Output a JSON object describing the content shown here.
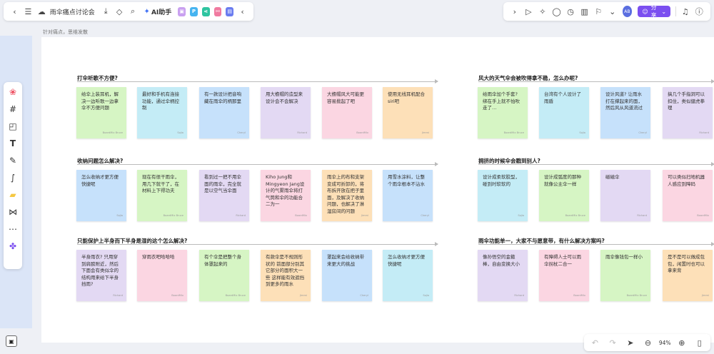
{
  "topbar": {
    "doc_title": "雨伞痛点讨论会",
    "ai_label": "AI助手",
    "share_label": "分享",
    "avatar_text": "AB",
    "colors": {
      "share": "#7b4ff0"
    }
  },
  "breadcrumb": "针对痛点，思维发散",
  "zoom": {
    "level": "94%"
  },
  "sections": [
    {
      "title": "打伞听歌不方便?",
      "notes": [
        {
          "text": "给伞上装耳机，解决一边听歌一边拿伞不方便问题",
          "author": "BoardMix Bruce",
          "color": "green"
        },
        {
          "text": "最好和手机有连接功能，通过伞柄控制",
          "author": "Sojia",
          "color": "cyan"
        },
        {
          "text": "有一款设计把音响藏在雨伞的柄那里",
          "author": "Cheryl",
          "color": "blue"
        },
        {
          "text": "用大檐帽的造型来设计会不会解决",
          "author": "Richard",
          "color": "purple"
        },
        {
          "text": "大檐帽风大可能更容易掀起了吧",
          "author": "BoardMix",
          "color": "pink"
        },
        {
          "text": "使用无线耳机配合siri吧",
          "author": "Jimmi",
          "color": "orange"
        }
      ]
    },
    {
      "title": "收纳问题怎么解决?",
      "notes": [
        {
          "text": "怎么收纳才更方便快捷呢",
          "author": "Sojia",
          "color": "blue"
        },
        {
          "text": "现在有很干雨伞，用几下就干了，在材料上下得功夫",
          "author": "BoardMix Bruce",
          "color": "green"
        },
        {
          "text": "看到过一把不用伞面的雨伞，完全就是以空气当伞面",
          "author": "Richard",
          "color": "purple"
        },
        {
          "text": "Kiho Jung和Mingyeon Jang设计的气雾雨伞将打气筒和伞的功能合二为一",
          "author": "BoardMix",
          "color": "pink"
        },
        {
          "text": "雨伞上的布和支架变成可折卸的，将布拆开放在把子里面，及解决了收纳问题，也解决了淋湿房间的问题",
          "author": "Jimmi",
          "color": "orange"
        },
        {
          "text": "用雪水涂料，让整个雨伞根本不沾水",
          "author": "Cheryl",
          "color": "blue"
        }
      ]
    },
    {
      "title": "只能保护上半身而下半身是湿的这个怎么解决?",
      "notes": [
        {
          "text": "半身雨衣? 只用穿到肩膀附近，然后下面会有类似伞的结构用来给下半身挡雨?",
          "author": "Richard",
          "color": "purple"
        },
        {
          "text": "穿雨衣吧哈哈哈",
          "author": "BoardMix",
          "color": "pink"
        },
        {
          "text": "有个伞是把整个身体罩起来的",
          "author": "BoardMix Bruce",
          "color": "green"
        },
        {
          "text": "有款伞是不规则形状的 前面部分别其它部分的面积大一些 这样能有效遮挡到更多的雨水",
          "author": "Jimmi",
          "color": "orange"
        },
        {
          "text": "罩起来会给收纳带来更大的挑战",
          "author": "Cheryl",
          "color": "blue"
        },
        {
          "text": "怎么收纳才更方便快捷呢",
          "author": "Sojia",
          "color": "cyan"
        }
      ]
    },
    {
      "title": "风大的天气伞会被吹得拿不稳，怎么办呢?",
      "notes": [
        {
          "text": "给雨伞加个手套? 绑在手上就不怕吹走了…",
          "author": "BoardMix Bruce",
          "color": "green"
        },
        {
          "text": "台湾有个人设计了雨盾",
          "author": "Sojia",
          "color": "cyan"
        },
        {
          "text": "设计风道? 让雨水打在撑起来的面，然后风从风道流过",
          "author": "Cheryl",
          "color": "blue"
        },
        {
          "text": "搞几个手指洞可以扣住，类似健虎拳理",
          "author": "Richard",
          "color": "purple"
        }
      ]
    },
    {
      "title": "拥挤的时候伞会戳到别人?",
      "notes": [
        {
          "text": "设计成柔软胶型，碰到时软软的",
          "author": "Sojia",
          "color": "cyan"
        },
        {
          "text": "设计成弧度的那种 就像公主伞一样",
          "author": "BoardMix Bruce",
          "color": "green"
        },
        {
          "text": "磁磁伞",
          "author": "Richard",
          "color": "purple"
        },
        {
          "text": "可以类似扫地机器人感应到障码",
          "author": "BoardMix",
          "color": "pink"
        }
      ]
    },
    {
      "title": "雨伞功能单一，大家不与愿意带，有什么解决方案吗?",
      "notes": [
        {
          "text": "像孙悟空的金箍棒，自由变换大小",
          "author": "Richard",
          "color": "purple"
        },
        {
          "text": "有障碍人士可以雨伞拐杖二合一",
          "author": "BoardMix",
          "color": "pink"
        },
        {
          "text": "雨伞像钱包一样小",
          "author": "BoardMix Bruce",
          "color": "green"
        },
        {
          "text": "是不是可以做成包包，闲置时也可以拿来背",
          "author": "Jimmi",
          "color": "orange"
        }
      ]
    }
  ]
}
